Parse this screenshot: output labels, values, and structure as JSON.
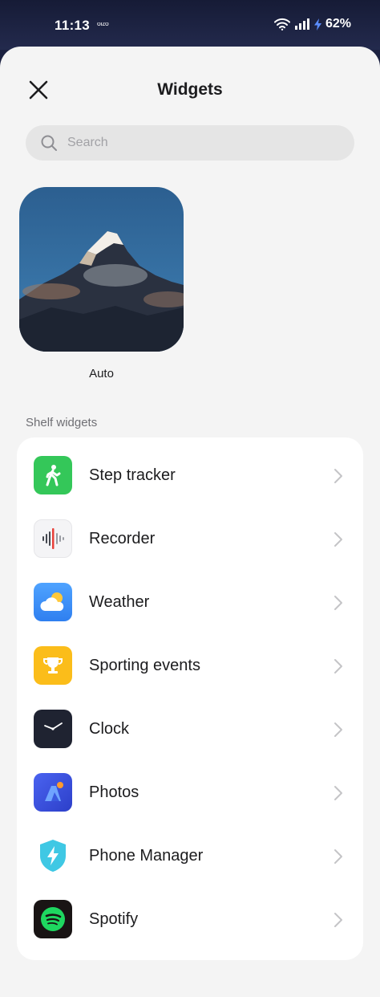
{
  "status": {
    "time": "11:13",
    "tag": "OIZO",
    "battery": "62%"
  },
  "header": {
    "title": "Widgets"
  },
  "search": {
    "placeholder": "Search",
    "value": ""
  },
  "auto_widget": {
    "label": "Auto"
  },
  "section": {
    "label": "Shelf widgets"
  },
  "widgets": [
    {
      "label": "Step tracker",
      "icon": "step-tracker-icon",
      "color": "#34c759"
    },
    {
      "label": "Recorder",
      "icon": "recorder-icon",
      "color": "#f4f4f6"
    },
    {
      "label": "Weather",
      "icon": "weather-icon",
      "color": "#3b8cf5"
    },
    {
      "label": "Sporting events",
      "icon": "sporting-events-icon",
      "color": "#fbbd1a"
    },
    {
      "label": "Clock",
      "icon": "clock-icon",
      "color": "#1f2331"
    },
    {
      "label": "Photos",
      "icon": "photos-icon",
      "color": "#3c4ed8"
    },
    {
      "label": "Phone Manager",
      "icon": "phone-manager-icon",
      "color": "#3fc8e4"
    },
    {
      "label": "Spotify",
      "icon": "spotify-icon",
      "color": "#191414"
    }
  ]
}
